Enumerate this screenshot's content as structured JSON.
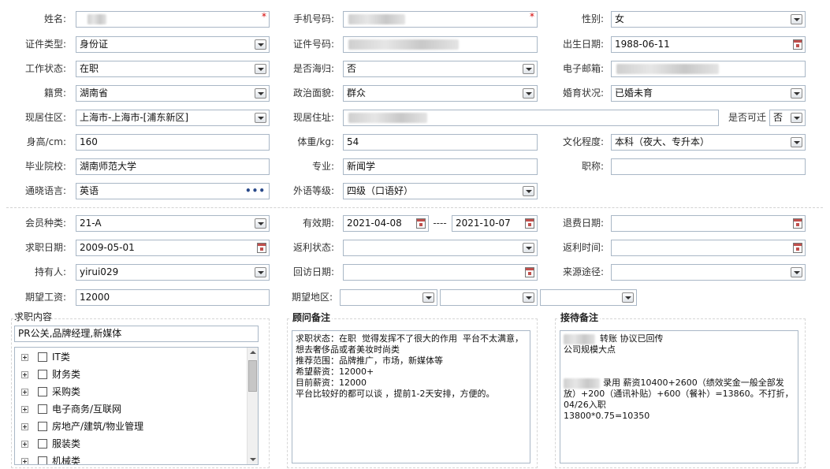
{
  "personal": {
    "name": {
      "label": "姓名:",
      "value": ""
    },
    "phone": {
      "label": "手机号码:",
      "value": ""
    },
    "gender": {
      "label": "性别:",
      "value": "女"
    },
    "id_type": {
      "label": "证件类型:",
      "value": "身份证"
    },
    "id_number": {
      "label": "证件号码:",
      "value": ""
    },
    "birth_date": {
      "label": "出生日期:",
      "value": "1988-06-11"
    },
    "work_status": {
      "label": "工作状态:",
      "value": "在职"
    },
    "returnee": {
      "label": "是否海归:",
      "value": "否"
    },
    "email": {
      "label": "电子邮箱:",
      "value": ""
    },
    "native_place": {
      "label": "籍贯:",
      "value": "湖南省"
    },
    "political_status": {
      "label": "政治面貌:",
      "value": "群众"
    },
    "marital_status": {
      "label": "婚育状况:",
      "value": "已婚未育"
    },
    "current_area": {
      "label": "现居住区:",
      "value": "上海市-上海市-[浦东新区]"
    },
    "current_address": {
      "label": "现居住址:",
      "value": ""
    },
    "relocatable": {
      "label": "是否可迁",
      "value": "否"
    },
    "height": {
      "label": "身高/cm:",
      "value": "160"
    },
    "weight": {
      "label": "体重/kg:",
      "value": "54"
    },
    "education": {
      "label": "文化程度:",
      "value": "本科（夜大、专升本）"
    },
    "school": {
      "label": "毕业院校:",
      "value": "湖南师范大学"
    },
    "major": {
      "label": "专业:",
      "value": "新闻学"
    },
    "title": {
      "label": "职称:",
      "value": ""
    },
    "language": {
      "label": "通晓语言:",
      "value": "英语",
      "more": "•••"
    },
    "language_level": {
      "label": "外语等级:",
      "value": "四级（口语好）"
    }
  },
  "membership": {
    "member_type": {
      "label": "会员种类:",
      "value": "21-A"
    },
    "valid_period": {
      "label": "有效期:",
      "start": "2021-04-08",
      "separator": "----",
      "end": "2021-10-07"
    },
    "refund_date": {
      "label": "退费日期:",
      "value": ""
    },
    "job_search_date": {
      "label": "求职日期:",
      "value": "2009-05-01"
    },
    "rebate_status": {
      "label": "返利状态:",
      "value": ""
    },
    "rebate_time": {
      "label": "返利时间:",
      "value": ""
    },
    "holder": {
      "label": "持有人:",
      "value": "yirui029"
    },
    "revisit_date": {
      "label": "回访日期:",
      "value": ""
    },
    "source": {
      "label": "来源途径:",
      "value": ""
    },
    "expected_salary": {
      "label": "期望工资:",
      "value": "12000"
    },
    "expected_region": {
      "label": "期望地区:",
      "values": [
        "",
        "",
        ""
      ]
    }
  },
  "job_content": {
    "title": "求职内容",
    "selected": "PR公关,品牌经理,新媒体",
    "categories": [
      "IT类",
      "财务类",
      "采购类",
      "电子商务/互联网",
      "房地产/建筑/物业管理",
      "服装类",
      "机械类"
    ]
  },
  "consultant_notes": {
    "title": "顾问备注",
    "text": "求职状态：在职  觉得发挥不了很大的作用  平台不太满意，想去奢侈品或者美妆时尚类\n推荐范围：品牌推广，市场，新媒体等\n希望薪资：12000+\n目前薪资：12000\n平台比较好的都可以谈 ，提前1-2天安排，方便的。"
  },
  "reception_notes": {
    "title": "接待备注",
    "line1": "转账  协议已回传",
    "line2": "公司规模大点",
    "line3": "录用  薪资10400+2600（绩效奖金一般全部发放）+200（通讯补贴）+600（餐补）=13860。不打折，04/26入职",
    "line4": "13800*0.75=10350"
  },
  "icons": {
    "required": "*"
  }
}
